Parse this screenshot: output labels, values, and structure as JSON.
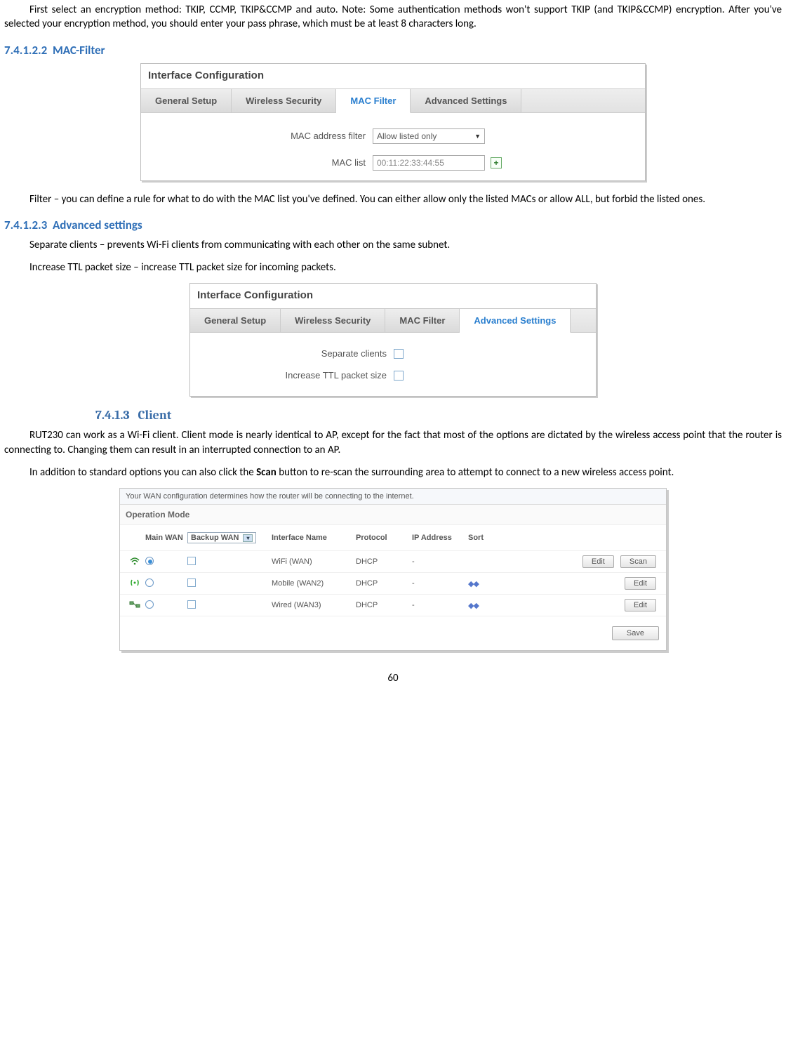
{
  "intro_para": "First select an encryption method: TKIP, CCMP, TKIP&CCMP and auto. Note: Some authentication methods won't support TKIP (and TKIP&CCMP) encryption.  After you've selected your encryption method, you should enter your pass phrase, which must be at least 8 characters long.",
  "sec_macfilter": {
    "num": "7.4.1.2.2",
    "title": "MAC-Filter"
  },
  "mac_panel": {
    "title": "Interface Configuration",
    "tabs": [
      "General Setup",
      "Wireless Security",
      "MAC Filter",
      "Advanced Settings"
    ],
    "active_tab": 2,
    "row1_label": "MAC address filter",
    "row1_value": "Allow listed only",
    "row2_label": "MAC list",
    "row2_value": "00:11:22:33:44:55"
  },
  "mac_para": "Filter – you can define a rule for what to do with the MAC list you've defined. You can either allow only the listed MACs or allow ALL, but forbid the listed ones.",
  "sec_adv": {
    "num": "7.4.1.2.3",
    "title": "Advanced settings"
  },
  "adv_p1": "Separate clients – prevents Wi-Fi clients from communicating with each other on the same subnet.",
  "adv_p2": "Increase TTL packet size – increase TTL packet size for incoming packets.",
  "adv_panel": {
    "title": "Interface Configuration",
    "tabs": [
      "General Setup",
      "Wireless Security",
      "MAC Filter",
      "Advanced Settings"
    ],
    "active_tab": 3,
    "row1_label": "Separate clients",
    "row2_label": "Increase TTL packet size"
  },
  "sec_client": {
    "num": "7.4.1.3",
    "title": "Client"
  },
  "client_p1": "RUT230 can work as a Wi-Fi client. Client mode is nearly identical to AP, except for the fact that most of the options are dictated by the wireless access point that the router is connecting to. Changing them can result in an interrupted connection to an AP.",
  "client_p2_a": "In addition to standard options you can also click the ",
  "client_p2_bold": "Scan",
  "client_p2_b": " button to re-scan the surrounding area to attempt to connect to a new wireless access point.",
  "wan": {
    "desc": "Your WAN configuration determines how the router will be connecting to the internet.",
    "mode_title": "Operation Mode",
    "headers": {
      "main_wan": "Main WAN",
      "backup_wan": "Backup WAN",
      "iface": "Interface Name",
      "proto": "Protocol",
      "ip": "IP Address",
      "sort": "Sort"
    },
    "rows": [
      {
        "icon": "wifi",
        "radio": true,
        "backup_cb": false,
        "iface": "WiFi (WAN)",
        "proto": "DHCP",
        "ip": "-",
        "sort": false,
        "edit": true,
        "scan": true
      },
      {
        "icon": "mobile",
        "radio": false,
        "backup_cb": false,
        "iface": "Mobile (WAN2)",
        "proto": "DHCP",
        "ip": "-",
        "sort": true,
        "edit": true,
        "scan": false
      },
      {
        "icon": "wired",
        "radio": false,
        "backup_cb": false,
        "iface": "Wired (WAN3)",
        "proto": "DHCP",
        "ip": "-",
        "sort": true,
        "edit": true,
        "scan": false
      }
    ],
    "edit_label": "Edit",
    "scan_label": "Scan",
    "save_label": "Save"
  },
  "page_number": "60"
}
